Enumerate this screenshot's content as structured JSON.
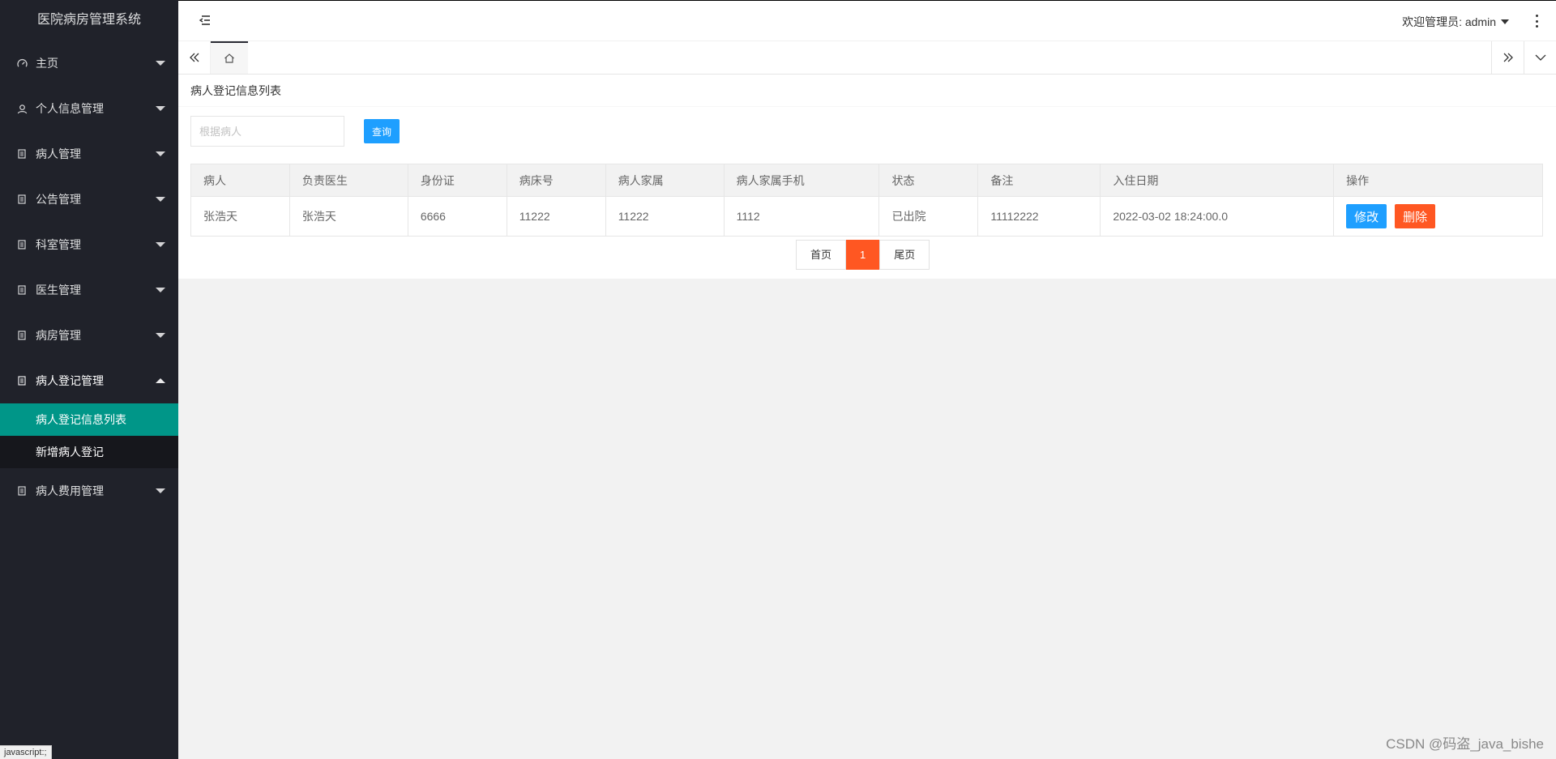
{
  "app": {
    "title": "医院病房管理系统"
  },
  "sidebar": {
    "items": [
      {
        "label": "主页",
        "icon": "dashboard-icon"
      },
      {
        "label": "个人信息管理",
        "icon": "user-icon"
      },
      {
        "label": "病人管理",
        "icon": "file-icon"
      },
      {
        "label": "公告管理",
        "icon": "file-icon"
      },
      {
        "label": "科室管理",
        "icon": "file-icon"
      },
      {
        "label": "医生管理",
        "icon": "file-icon"
      },
      {
        "label": "病房管理",
        "icon": "file-icon"
      },
      {
        "label": "病人登记管理",
        "icon": "file-icon",
        "expanded": true
      },
      {
        "label": "病人费用管理",
        "icon": "file-icon"
      }
    ],
    "submenu": [
      {
        "label": "病人登记信息列表",
        "active": true
      },
      {
        "label": "新增病人登记",
        "active": false
      }
    ],
    "accent_color": "#009688",
    "background_color": "#20222a"
  },
  "header": {
    "welcome": "欢迎管理员: admin"
  },
  "page": {
    "title": "病人登记信息列表",
    "search_placeholder": "根据病人",
    "search_button": "查询"
  },
  "table": {
    "columns": [
      "病人",
      "负责医生",
      "身份证",
      "病床号",
      "病人家属",
      "病人家属手机",
      "状态",
      "备注",
      "入住日期",
      "操作"
    ],
    "rows": [
      {
        "cells": [
          "张浩天",
          "张浩天",
          "6666",
          "11222",
          "11222",
          "1112",
          "已出院",
          "11112222",
          "2022-03-02 18:24:00.0"
        ],
        "edit": "修改",
        "delete": "删除"
      }
    ]
  },
  "pagination": {
    "first": "首页",
    "current": "1",
    "last": "尾页"
  },
  "status_bar": "javascript:;",
  "watermark": "CSDN @码盗_java_bishe"
}
